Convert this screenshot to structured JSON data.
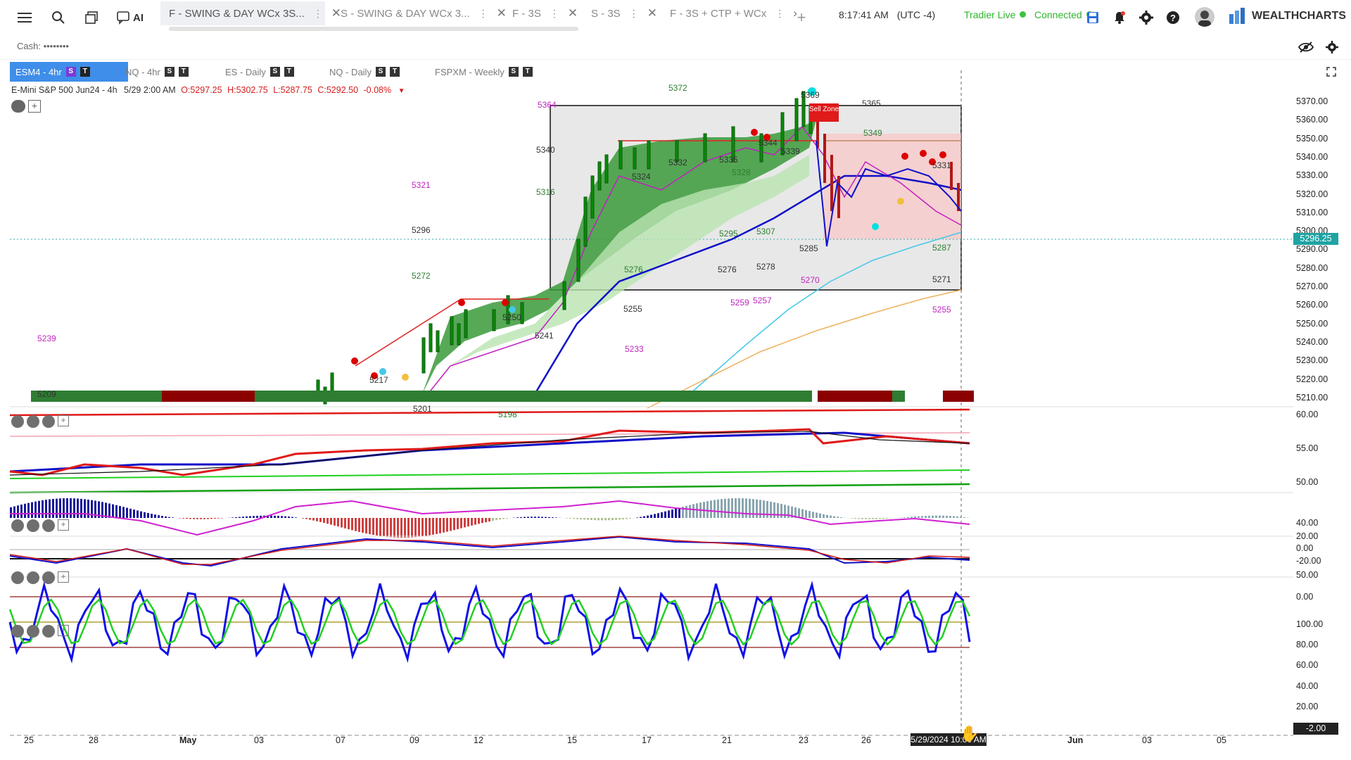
{
  "toolbar": {
    "menu_icon": "menu-icon",
    "search_icon": "search-icon",
    "layouts_icon": "layouts-icon",
    "ai_label": "AI"
  },
  "tabs": [
    {
      "label": "F - SWING & DAY WCx 3S...",
      "active": true
    },
    {
      "label": "S - SWING & DAY WCx 3...",
      "active": false
    },
    {
      "label": "F - 3S",
      "active": false
    },
    {
      "label": "S - 3S",
      "active": false
    },
    {
      "label": "F - 3S + CTP + WCx",
      "active": false
    }
  ],
  "status": {
    "time": "8:17:41 AM",
    "timezone": "(UTC -4)",
    "broker": "Tradier Live",
    "connection": "Connected",
    "broker_color": "#2fb52f",
    "connection_color": "#2fb52f"
  },
  "brand": {
    "name": "WEALTHCHARTS"
  },
  "account": {
    "cash_label": "Cash: ••••••••"
  },
  "chart_tabs": [
    {
      "label": "ESM4 - 4hr",
      "active": true
    },
    {
      "label": "NQ - 4hr",
      "active": false
    },
    {
      "label": "ES - Daily",
      "active": false
    },
    {
      "label": "NQ - Daily",
      "active": false
    },
    {
      "label": "FSPXM - Weekly",
      "active": false
    }
  ],
  "badges": {
    "s": "S",
    "t": "T"
  },
  "ohlc": {
    "symbol_desc": "E-Mini S&P 500 Jun24 - 4h",
    "date": "5/29 2:00 AM",
    "o": "O:5297.25",
    "h": "H:5302.75",
    "l": "L:5287.75",
    "c": "C:5292.50",
    "change": "-0.08%"
  },
  "chart_data": {
    "type": "candlestick",
    "price_axis": [
      "5370.00",
      "5360.00",
      "5350.00",
      "5340.00",
      "5330.00",
      "5320.00",
      "5310.00",
      "5300.00",
      "5290.00",
      "5280.00",
      "5270.00",
      "5260.00",
      "5250.00",
      "5240.00",
      "5230.00",
      "5220.00",
      "5210.00"
    ],
    "last_price": "5296.25",
    "x_labels": [
      "25",
      "28",
      "May",
      "03",
      "07",
      "09",
      "12",
      "15",
      "17",
      "21",
      "23",
      "26",
      "Jun",
      "03",
      "05"
    ],
    "crosshair_date": "5/29/2024 10:00 AM",
    "levels": [
      {
        "label": "5372",
        "color": "#2e7d32"
      },
      {
        "label": "5369",
        "color": "#333"
      },
      {
        "label": "5365",
        "color": "#333"
      },
      {
        "label": "5364",
        "color": "#c026c0"
      },
      {
        "label": "5349",
        "color": "#2e7d32"
      },
      {
        "label": "5344",
        "color": "#333"
      },
      {
        "label": "5340",
        "color": "#333"
      },
      {
        "label": "5339",
        "color": "#333"
      },
      {
        "label": "5335",
        "color": "#333"
      },
      {
        "label": "5332",
        "color": "#333"
      },
      {
        "label": "5331",
        "color": "#333"
      },
      {
        "label": "5328",
        "color": "#2e7d32"
      },
      {
        "label": "5324",
        "color": "#333"
      },
      {
        "label": "5321",
        "color": "#c026c0"
      },
      {
        "label": "5316",
        "color": "#2e7d32"
      },
      {
        "label": "5307",
        "color": "#2e7d32"
      },
      {
        "label": "5296",
        "color": "#333"
      },
      {
        "label": "5295",
        "color": "#2e7d32"
      },
      {
        "label": "5287",
        "color": "#2e7d32"
      },
      {
        "label": "5285",
        "color": "#333"
      },
      {
        "label": "5278",
        "color": "#333"
      },
      {
        "label": "5276",
        "color": "#333"
      },
      {
        "label": "5276",
        "color": "#2e7d32"
      },
      {
        "label": "5272",
        "color": "#2e7d32"
      },
      {
        "label": "5271",
        "color": "#333"
      },
      {
        "label": "5270",
        "color": "#c026c0"
      },
      {
        "label": "5259",
        "color": "#c026c0"
      },
      {
        "label": "5257",
        "color": "#c026c0"
      },
      {
        "label": "5255",
        "color": "#333"
      },
      {
        "label": "5255",
        "color": "#c026c0"
      },
      {
        "label": "5250",
        "color": "#333"
      },
      {
        "label": "5241",
        "color": "#333"
      },
      {
        "label": "5239",
        "color": "#c026c0"
      },
      {
        "label": "5233",
        "color": "#c026c0"
      },
      {
        "label": "5217",
        "color": "#333"
      },
      {
        "label": "5209",
        "color": "#333"
      },
      {
        "label": "5201",
        "color": "#333"
      },
      {
        "label": "5198",
        "color": "#2e7d32"
      }
    ],
    "sell_zone_label": "Sell Zone",
    "indicator1_axis": [
      "60.00",
      "55.00",
      "50.00"
    ],
    "indicator2_axis": [
      "40.00",
      "20.00",
      "0.00",
      "-20.00"
    ],
    "indicator3_axis": [
      "50.00",
      "0.00"
    ],
    "indicator4_axis": [
      "100.00",
      "80.00",
      "60.00",
      "40.00",
      "20.00",
      "-2.00"
    ]
  }
}
